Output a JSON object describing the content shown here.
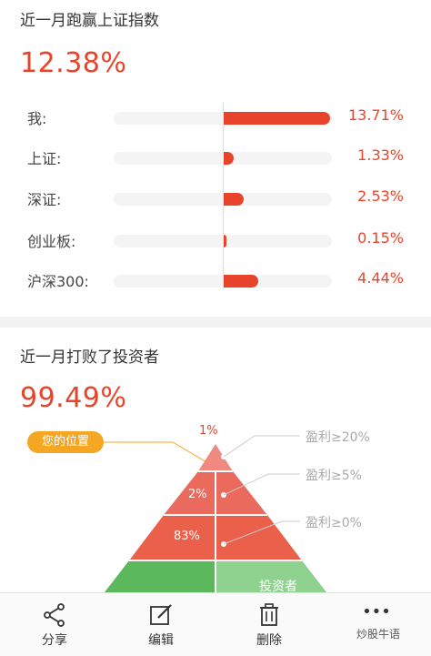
{
  "card1": {
    "title": "近一月跑赢上证指数",
    "value": "12.38%",
    "rows": [
      {
        "label": "我:",
        "value": "13.71%",
        "pct": 13.71
      },
      {
        "label": "上证:",
        "value": "1.33%",
        "pct": 1.33
      },
      {
        "label": "深证:",
        "value": "2.53%",
        "pct": 2.53
      },
      {
        "label": "创业板:",
        "value": "0.15%",
        "pct": 0.15
      },
      {
        "label": "沪深300:",
        "value": "4.44%",
        "pct": 4.44
      }
    ]
  },
  "card2": {
    "title": "近一月打败了投资者",
    "value": "99.49%",
    "position_badge": "您的位置",
    "pyramid": {
      "top_pct": "1%",
      "mid_pct": "2%",
      "low_pct": "83%",
      "base_text": "投资者",
      "tiers": [
        "盈利≥20%",
        "盈利≥5%",
        "盈利≥0%"
      ]
    }
  },
  "toolbar": {
    "share": "分享",
    "edit": "编辑",
    "delete": "删除",
    "more": "•••"
  },
  "watermark": "炒股牛语",
  "colors": {
    "accent": "#e8442b",
    "badge": "#f5a623",
    "green": "#5cb85c"
  }
}
